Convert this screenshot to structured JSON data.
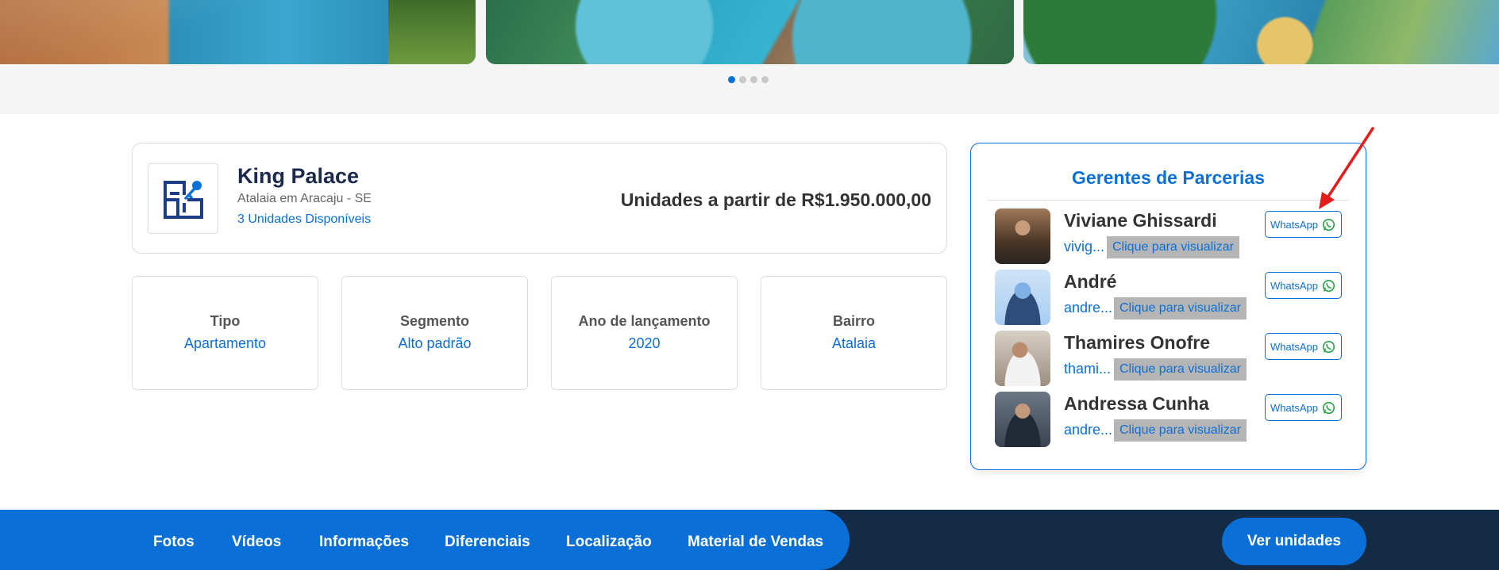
{
  "gallery": {
    "slide_count": 4,
    "active_slide": 1
  },
  "property": {
    "name": "King Palace",
    "location": "Atalaia em Aracaju - SE",
    "units_available": "3 Unidades Disponíveis",
    "price_text": "Unidades a partir de R$1.950.000,00"
  },
  "info": [
    {
      "label": "Tipo",
      "value": "Apartamento"
    },
    {
      "label": "Segmento",
      "value": "Alto padrão"
    },
    {
      "label": "Ano de lançamento",
      "value": "2020"
    },
    {
      "label": "Bairro",
      "value": "Atalaia"
    }
  ],
  "managers": {
    "title": "Gerentes de Parcerias",
    "whatsapp_label": "WhatsApp",
    "reveal_label": "Clique para visualizar",
    "items": [
      {
        "name": "Viviane Ghissardi",
        "email": "vivig..."
      },
      {
        "name": "André",
        "email": "andre..."
      },
      {
        "name": "Thamires Onofre",
        "email": "thami..."
      },
      {
        "name": "Andressa Cunha",
        "email": "andre..."
      }
    ]
  },
  "nav": {
    "items": [
      "Fotos",
      "Vídeos",
      "Informações",
      "Diferenciais",
      "Localização",
      "Material de Vendas"
    ],
    "cta": "Ver unidades"
  },
  "colors": {
    "accent": "#0b6fd8",
    "navy": "#132b45",
    "annotation": "#e51c1c"
  }
}
